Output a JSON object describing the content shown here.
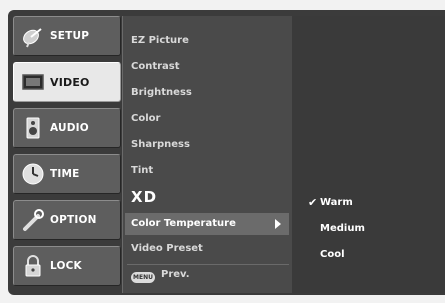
{
  "tabs": [
    {
      "label": "SETUP",
      "icon": "satellite-dish-icon"
    },
    {
      "label": "VIDEO",
      "icon": "monitor-icon"
    },
    {
      "label": "AUDIO",
      "icon": "speaker-icon"
    },
    {
      "label": "TIME",
      "icon": "clock-icon"
    },
    {
      "label": "OPTION",
      "icon": "wrench-icon"
    },
    {
      "label": "LOCK",
      "icon": "padlock-icon"
    }
  ],
  "active_tab": "VIDEO",
  "menu_items": [
    "EZ Picture",
    "Contrast",
    "Brightness",
    "Color",
    "Sharpness",
    "Tint",
    "XD",
    "Color Temperature",
    "Video Preset"
  ],
  "selected_item": "Color Temperature",
  "footer": {
    "button": "MENU",
    "label": "Prev."
  },
  "submenu": {
    "options": [
      "Warm",
      "Medium",
      "Cool"
    ],
    "checked": "Warm",
    "checkmark": "✔"
  },
  "colors": {
    "panel": "#3b3b3b",
    "menu_bg": "#4a4a4a",
    "highlight": "#6b6b6b",
    "active_tab": "#e8e8e8"
  }
}
